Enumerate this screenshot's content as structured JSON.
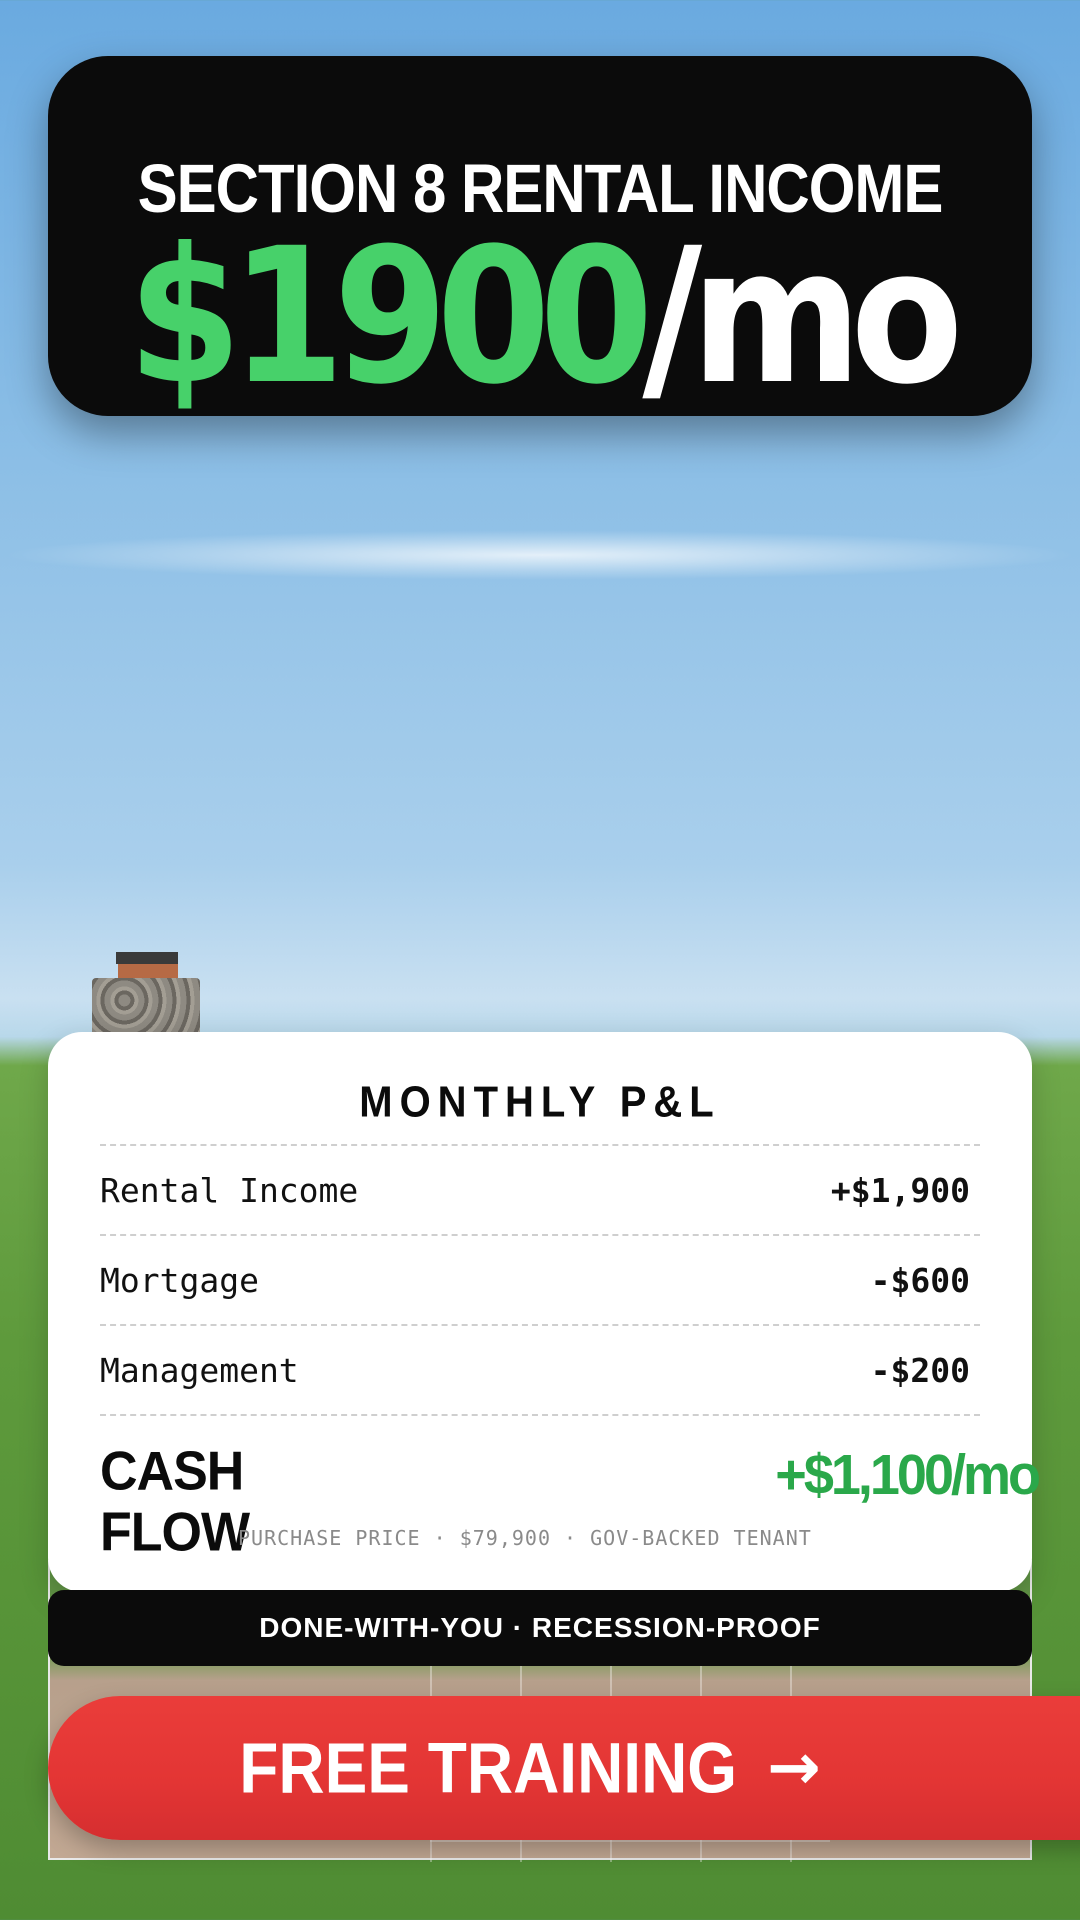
{
  "header": {
    "title": "SECTION 8 RENTAL INCOME",
    "amount": "$1900",
    "unit": "/mo"
  },
  "pl": {
    "title": "MONTHLY P&L",
    "rows": [
      {
        "label": "Rental Income",
        "value": "+$1,900"
      },
      {
        "label": "Mortgage",
        "value": "-$600"
      },
      {
        "label": "Management",
        "value": "-$200"
      }
    ],
    "cash_flow": {
      "label_line1": "CASH",
      "label_line2": "FLOW",
      "value": "+$1,100/mo",
      "subtext": "PURCHASE PRICE · $79,900 · GOV-BACKED TENANT"
    }
  },
  "tagline": "DONE-WITH-YOU · RECESSION-PROOF",
  "cta": {
    "label": "FREE TRAINING",
    "arrow_icon": "right-arrow-icon"
  },
  "colors": {
    "accent_green": "#47d16a",
    "cash_flow_green": "#2aa84a",
    "cta_red": "#e33534",
    "card_black": "#0b0b0b"
  }
}
